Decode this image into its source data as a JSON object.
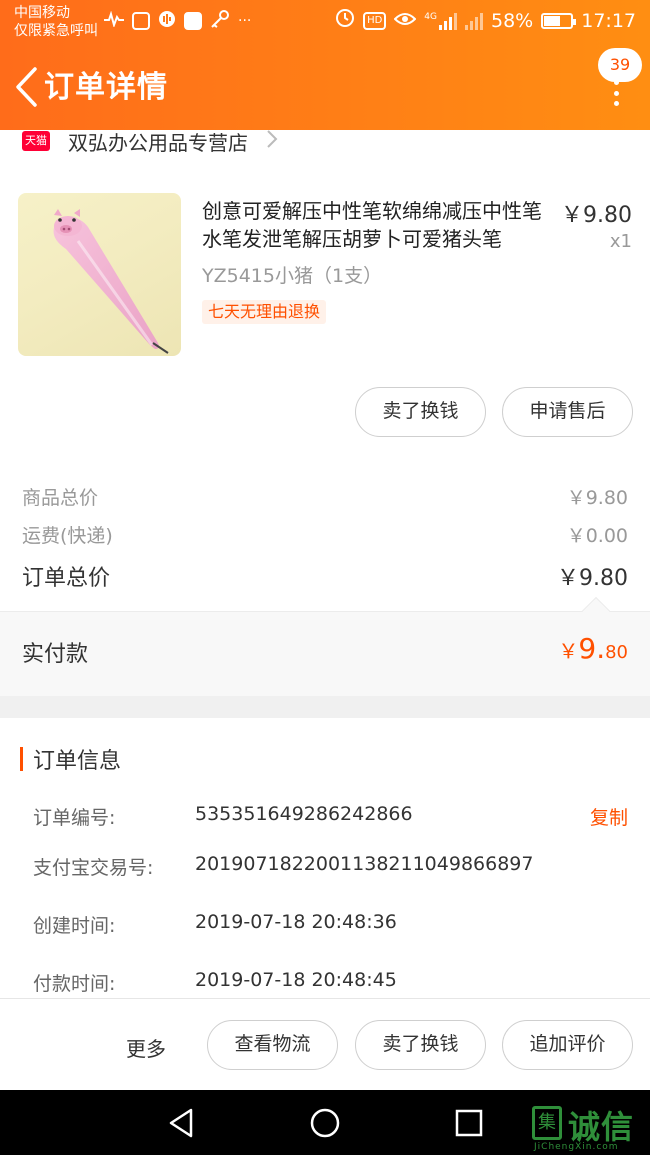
{
  "status_bar": {
    "carrier_line1": "中国移动",
    "carrier_line2": "仅限紧急呼叫",
    "network": "4G",
    "hd": "HD",
    "battery_percent": "58%",
    "time": "17:17",
    "overflow": "···"
  },
  "header": {
    "title": "订单详情",
    "message_count": "39"
  },
  "shop": {
    "badge": "天猫",
    "name": "双弘办公用品专营店"
  },
  "product": {
    "title": "创意可爱解压中性笔软绵绵减压中性笔水笔发泄笔解压胡萝卜可爱猪头笔",
    "price": "￥9.80",
    "quantity": "x1",
    "sku": "YZ5415小猪（1支）",
    "tag": "七天无理由退换",
    "buttons": {
      "sell": "卖了换钱",
      "after_sale": "申请售后"
    }
  },
  "summary": {
    "goods_total_label": "商品总价",
    "goods_total_value": "￥9.80",
    "shipping_label": "运费(快递)",
    "shipping_value": "￥0.00",
    "order_total_label": "订单总价",
    "order_total_value": "￥9.80",
    "paid_label": "实付款",
    "paid_currency": "￥",
    "paid_integer": "9.",
    "paid_decimal": "80"
  },
  "order_info": {
    "title": "订单信息",
    "order_no_label": "订单编号:",
    "order_no": "535351649286242866",
    "copy": "复制",
    "alipay_no_label": "支付宝交易号:",
    "alipay_no": "2019071822001138211049866897",
    "created_label": "创建时间:",
    "created": "2019-07-18 20:48:36",
    "paid_time_label": "付款时间:",
    "paid_time": "2019-07-18 20:48:45"
  },
  "bottom_bar": {
    "more": "更多",
    "logistics": "查看物流",
    "sell": "卖了换钱",
    "review": "追加评价"
  },
  "watermark": {
    "glyph": "集",
    "text": "诚信",
    "sub": "JiChengXin.com"
  },
  "colors": {
    "brand_orange": "#ff5000",
    "header_start": "#ff6c1a",
    "header_end": "#ff8e12",
    "tmall_red": "#ff0036",
    "watermark_green": "#2f8f3a"
  }
}
